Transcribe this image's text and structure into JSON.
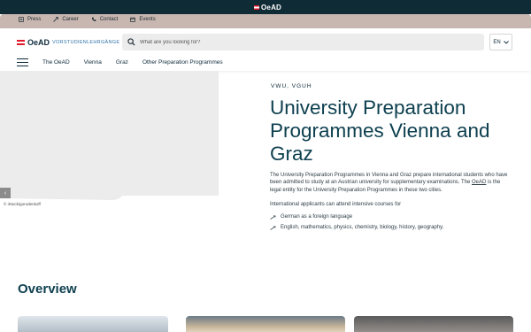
{
  "topbar": {
    "logo_text": "OeAD"
  },
  "utility_nav": [
    {
      "label": "Press",
      "icon": "press-icon"
    },
    {
      "label": "Career",
      "icon": "career-icon"
    },
    {
      "label": "Contact",
      "icon": "contact-icon"
    },
    {
      "label": "Events",
      "icon": "events-icon"
    }
  ],
  "header": {
    "brand": "OeAD",
    "brand_sub": "VORSTUDIENLEHRGÄNGE",
    "search_placeholder": "What are you looking for?",
    "language": "EN"
  },
  "main_nav": [
    "The OeAD",
    "Vienna",
    "Graz",
    "Other Preparation Programmes"
  ],
  "hero": {
    "image_credit": "© iStock/gorodenkoff",
    "tags": "VWU, VGUH",
    "title": "University Preparation Programmes Vienna and Graz",
    "intro_part1": "The University Preparation Programmes in Vienna and Graz prepare international students who have been admitted to study at an Austrian university for supplementary examinations. The ",
    "intro_link": "OeAD",
    "intro_part2": " is the legal entity for the University Preparation Programmes in these two cities.",
    "applicants_text": "International applicants can attend intensive courses for",
    "courses": [
      "German as a foreign language",
      "English, mathematics, physics, chemistry, biology, history, geography."
    ]
  },
  "overview": {
    "title": "Overview"
  },
  "colors": {
    "dark_bar": "#0f2b36",
    "util_bar": "#c8b7b0",
    "title_teal": "#0e4050",
    "flag_red": "#e2192a"
  }
}
